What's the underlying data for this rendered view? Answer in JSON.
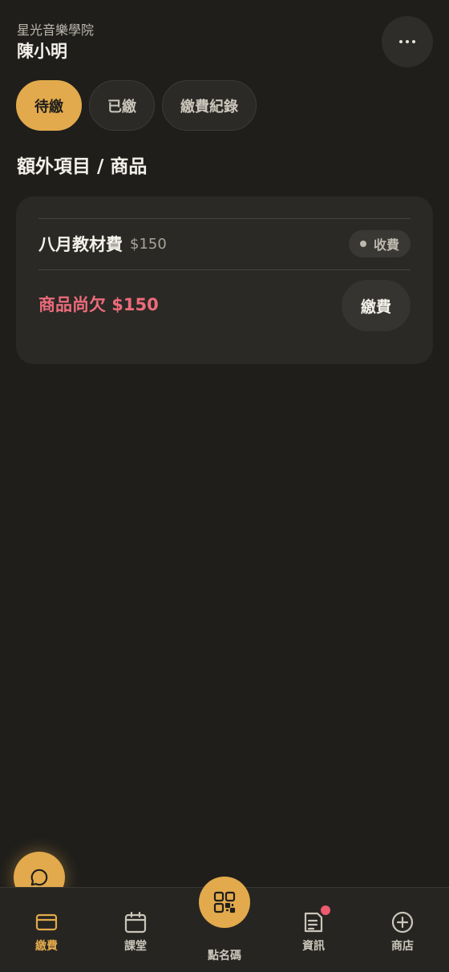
{
  "header": {
    "school_name": "星光音樂學院",
    "student_name": "陳小明"
  },
  "tabs": [
    {
      "label": "待繳",
      "active": true
    },
    {
      "label": "已繳",
      "active": false
    },
    {
      "label": "繳費紀錄",
      "active": false
    }
  ],
  "section": {
    "title": "額外項目 / 商品"
  },
  "items": [
    {
      "name": "八月教材費",
      "price": "$150",
      "status": "收費"
    }
  ],
  "summary": {
    "owed_text": "商品尚欠 $150",
    "pay_label": "繳費"
  },
  "nav": {
    "items": [
      {
        "label": "繳費",
        "icon": "card-icon",
        "active": true
      },
      {
        "label": "課堂",
        "icon": "calendar-icon",
        "active": false
      },
      {
        "label": "點名碼",
        "icon": "qr-code-icon",
        "active": false
      },
      {
        "label": "資訊",
        "icon": "news-icon",
        "active": false,
        "badge": true
      },
      {
        "label": "商店",
        "icon": "plus-circle-icon",
        "active": false
      }
    ]
  },
  "colors": {
    "accent": "#e2aa4c",
    "background": "#1f1e1b",
    "card": "#2a2925",
    "danger": "#ec6b7a",
    "badge": "#ec5b6e"
  }
}
